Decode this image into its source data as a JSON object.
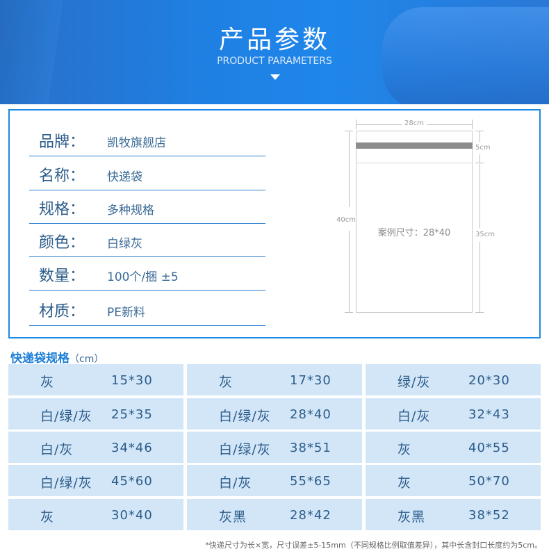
{
  "banner": {
    "title": "产品参数",
    "subtitle": "PRODUCT PARAMETERS"
  },
  "params": [
    {
      "key": "品牌：",
      "value": "凯牧旗舰店"
    },
    {
      "key": "名称：",
      "value": "快递袋"
    },
    {
      "key": "规格：",
      "value": "多种规格"
    },
    {
      "key": "颜色：",
      "value": "白绿灰"
    },
    {
      "key": "数量：",
      "value": "100个/捆 ±5"
    },
    {
      "key": "材质：",
      "value": "PE新料"
    }
  ],
  "diagram": {
    "width_label": "28cm",
    "flap_label": "5cm",
    "height_label": "40cm",
    "body_label": "35cm",
    "center_label": "案例尺寸：28*40"
  },
  "spec": {
    "title": "快递袋规格",
    "unit": "（cm）",
    "rows": [
      [
        {
          "color": "灰",
          "size": "15*30"
        },
        {
          "color": "灰",
          "size": "17*30"
        },
        {
          "color": "绿/灰",
          "size": "20*30"
        }
      ],
      [
        {
          "color": "白/绿/灰",
          "size": "25*35"
        },
        {
          "color": "白/绿/灰",
          "size": "28*40"
        },
        {
          "color": "白/灰",
          "size": "32*43"
        }
      ],
      [
        {
          "color": "白/灰",
          "size": "34*46"
        },
        {
          "color": "白/绿/灰",
          "size": "38*51"
        },
        {
          "color": "灰",
          "size": "40*55"
        }
      ],
      [
        {
          "color": "白/绿/灰",
          "size": "45*60"
        },
        {
          "color": "白/灰",
          "size": "55*65"
        },
        {
          "color": "灰",
          "size": "50*70"
        }
      ],
      [
        {
          "color": "灰",
          "size": "30*40"
        },
        {
          "color": "灰黑",
          "size": "28*42"
        },
        {
          "color": "灰黑",
          "size": "38*52"
        }
      ]
    ]
  },
  "footnote": "*快递尺寸为长×宽，尺寸误差±5-15mm（不同规格比例取值差异），其中长含封口长度约为5cm。"
}
